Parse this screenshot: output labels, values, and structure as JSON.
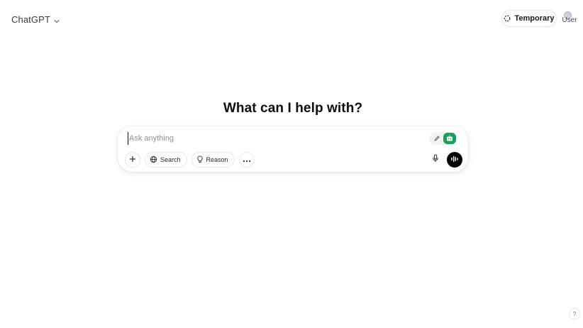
{
  "header": {
    "model_name": "ChatGPT",
    "temporary_label": "Temporary",
    "user_label": "User"
  },
  "main": {
    "headline": "What can I help with?"
  },
  "composer": {
    "placeholder": "Ask anything",
    "value": "",
    "tools": {
      "search_label": "Search",
      "reason_label": "Reason"
    }
  },
  "footer": {
    "help_label": "?"
  },
  "icons": {
    "model_chevron": "chevron-down-icon",
    "temporary": "temporary-chat-icon",
    "avatar": "avatar-icon",
    "pen": "pen-icon",
    "extension": "robot-icon",
    "add": "plus-icon",
    "search": "globe-icon",
    "reason": "lightbulb-icon",
    "more": "ellipsis-icon",
    "mic": "microphone-icon",
    "voice": "voice-mode-icon"
  },
  "colors": {
    "background": "#ffffff",
    "text": "#0d0d0d",
    "extension_accent": "#13a35a",
    "voice_button": "#000000"
  }
}
